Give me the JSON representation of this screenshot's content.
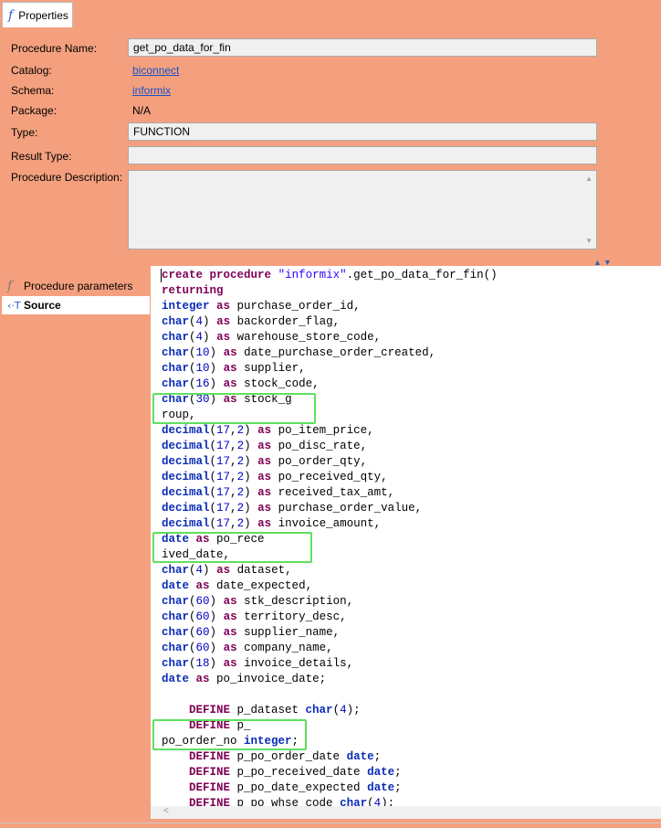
{
  "tab": {
    "icon": "function-icon",
    "label": "Properties"
  },
  "labels": {
    "procedure_name": "Procedure Name:",
    "catalog": "Catalog:",
    "schema": "Schema:",
    "package": "Package:",
    "type": "Type:",
    "result_type": "Result Type:",
    "procedure_description": "Procedure Description:"
  },
  "values": {
    "procedure_name": "get_po_data_for_fin",
    "catalog": "biconnect",
    "schema": "informix",
    "package": "N/A",
    "type": "FUNCTION",
    "result_type": "",
    "procedure_description": ""
  },
  "side_nav": [
    {
      "icon": "function-icon",
      "label": "Procedure parameters"
    },
    {
      "icon": "source-icon",
      "label": "Source"
    }
  ],
  "source_lines": [
    "create procedure \"informix\".get_po_data_for_fin()",
    "returning",
    "integer as purchase_order_id,",
    "char(4) as backorder_flag,",
    "char(4) as warehouse_store_code,",
    "char(10) as date_purchase_order_created,",
    "char(10) as supplier,",
    "char(16) as stock_code,",
    "char(30) as stock_g",
    "roup,",
    "decimal(17,2) as po_item_price,",
    "decimal(17,2) as po_disc_rate,",
    "decimal(17,2) as po_order_qty,",
    "decimal(17,2) as po_received_qty,",
    "decimal(17,2) as received_tax_amt,",
    "decimal(17,2) as purchase_order_value,",
    "decimal(17,2) as invoice_amount,",
    "date as po_rece",
    "ived_date,",
    "char(4) as dataset,",
    "date as date_expected,",
    "char(60) as stk_description,",
    "char(60) as territory_desc,",
    "char(60) as supplier_name,",
    "char(60) as company_name,",
    "char(18) as invoice_details,",
    "date as po_invoice_date;",
    "",
    "    DEFINE p_dataset char(4);",
    "    DEFINE p_",
    "po_order_no integer;",
    "    DEFINE p_po_order_date date;",
    "    DEFINE p_po_received_date date;",
    "    DEFINE p_po_date_expected date;",
    "    DEFINE p_po_whse_code char(4);"
  ],
  "colors": {
    "background": "#f4a07e",
    "highlight_box": "#5ee05e",
    "link": "#1a52c6"
  }
}
